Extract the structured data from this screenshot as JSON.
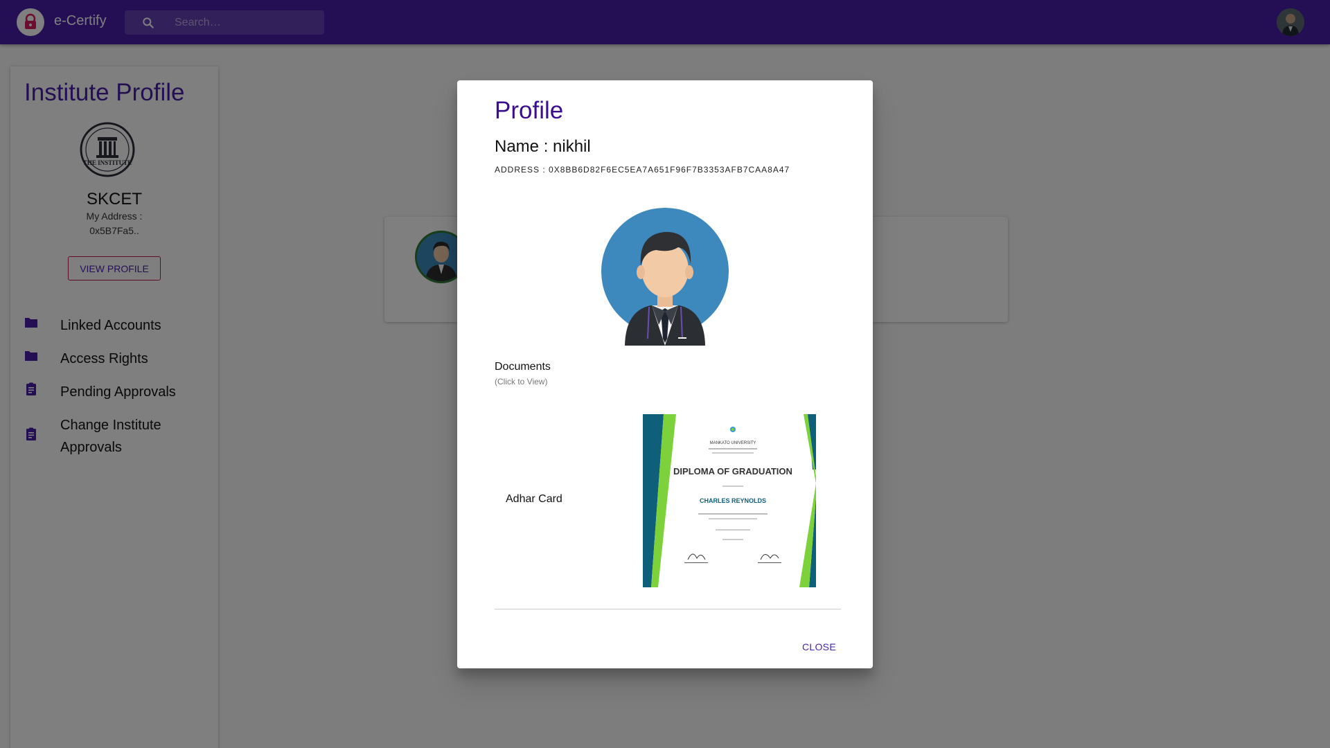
{
  "appbar": {
    "brand": "e-Certify",
    "search_placeholder": "Search…",
    "logo_icon": "lock-shield-icon",
    "colors": {
      "primary": "#4a1fa8",
      "accent": "#c2185b"
    }
  },
  "sidebar": {
    "title": "Institute Profile",
    "institute_name": "SKCET",
    "address_label": "My Address :",
    "address_value": "0x5B7Fa5..",
    "view_profile_label": "VIEW PROFILE",
    "logo_text": "THE INSTITUTE",
    "items": [
      {
        "label": "Linked Accounts",
        "icon": "folder-icon"
      },
      {
        "label": "Access Rights",
        "icon": "folder-icon"
      },
      {
        "label": "Pending Approvals",
        "icon": "clipboard-icon"
      },
      {
        "label": "Change Institute Approvals",
        "icon": "clipboard-icon"
      }
    ]
  },
  "dialog": {
    "title": "Profile",
    "name_line": "Name : nikhil",
    "address_line": "ADDRESS : 0X8BB6D82F6EC5EA7A651F96F7B3353AFB7CAA8A47",
    "documents_heading": "Documents",
    "documents_hint": "(Click to View)",
    "documents": [
      {
        "label": "Adhar Card",
        "thumb": {
          "university": "MANKATO UNIVERSITY",
          "heading": "DIPLOMA OF GRADUATION",
          "recipient": "CHARLES REYNOLDS"
        }
      }
    ],
    "close_label": "CLOSE"
  }
}
